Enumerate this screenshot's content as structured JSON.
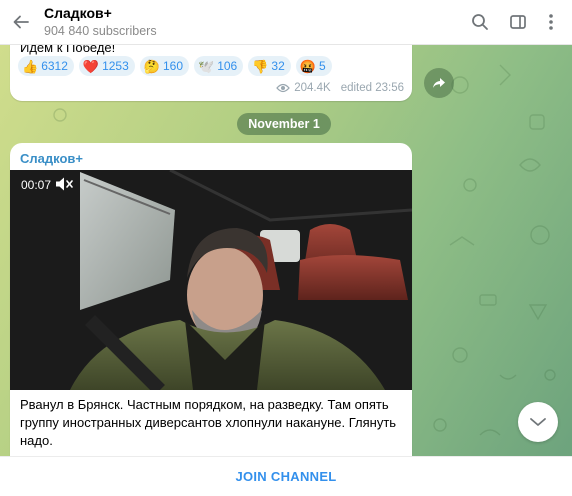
{
  "header": {
    "title": "Сладков+",
    "subtitle": "904 840 subscribers"
  },
  "previous_message": {
    "text": "Идем к Победе!",
    "reactions": [
      {
        "emoji": "👍",
        "count": "6312"
      },
      {
        "emoji": "❤️",
        "count": "1253"
      },
      {
        "emoji": "🤔",
        "count": "160"
      },
      {
        "emoji": "🕊️",
        "count": "106"
      },
      {
        "emoji": "👎",
        "count": "32"
      },
      {
        "emoji": "🤬",
        "count": "5"
      }
    ],
    "views": "204.4K",
    "edited": "edited 23:56"
  },
  "date_separator": "November 1",
  "message": {
    "sender": "Сладков+",
    "video_time": "00:07",
    "caption": "Рванул в Брянск. Частным порядком, на разведку. Там опять группу иностранных диверсантов хлопнули накануне. Глянуть надо."
  },
  "footer": {
    "join_label": "JOIN CHANNEL"
  },
  "icons": {
    "back": "arrow-left-icon",
    "search": "search-icon",
    "sidebar": "sidebar-toggle-icon",
    "menu": "more-vertical-icon",
    "share": "share-icon",
    "views": "eye-icon",
    "mute": "muted-speaker-icon",
    "scroll": "chevron-down-icon"
  },
  "colors": {
    "accent": "#3390ec",
    "sender": "#3a8fc7",
    "reaction_bg": "#e6f1f8"
  }
}
